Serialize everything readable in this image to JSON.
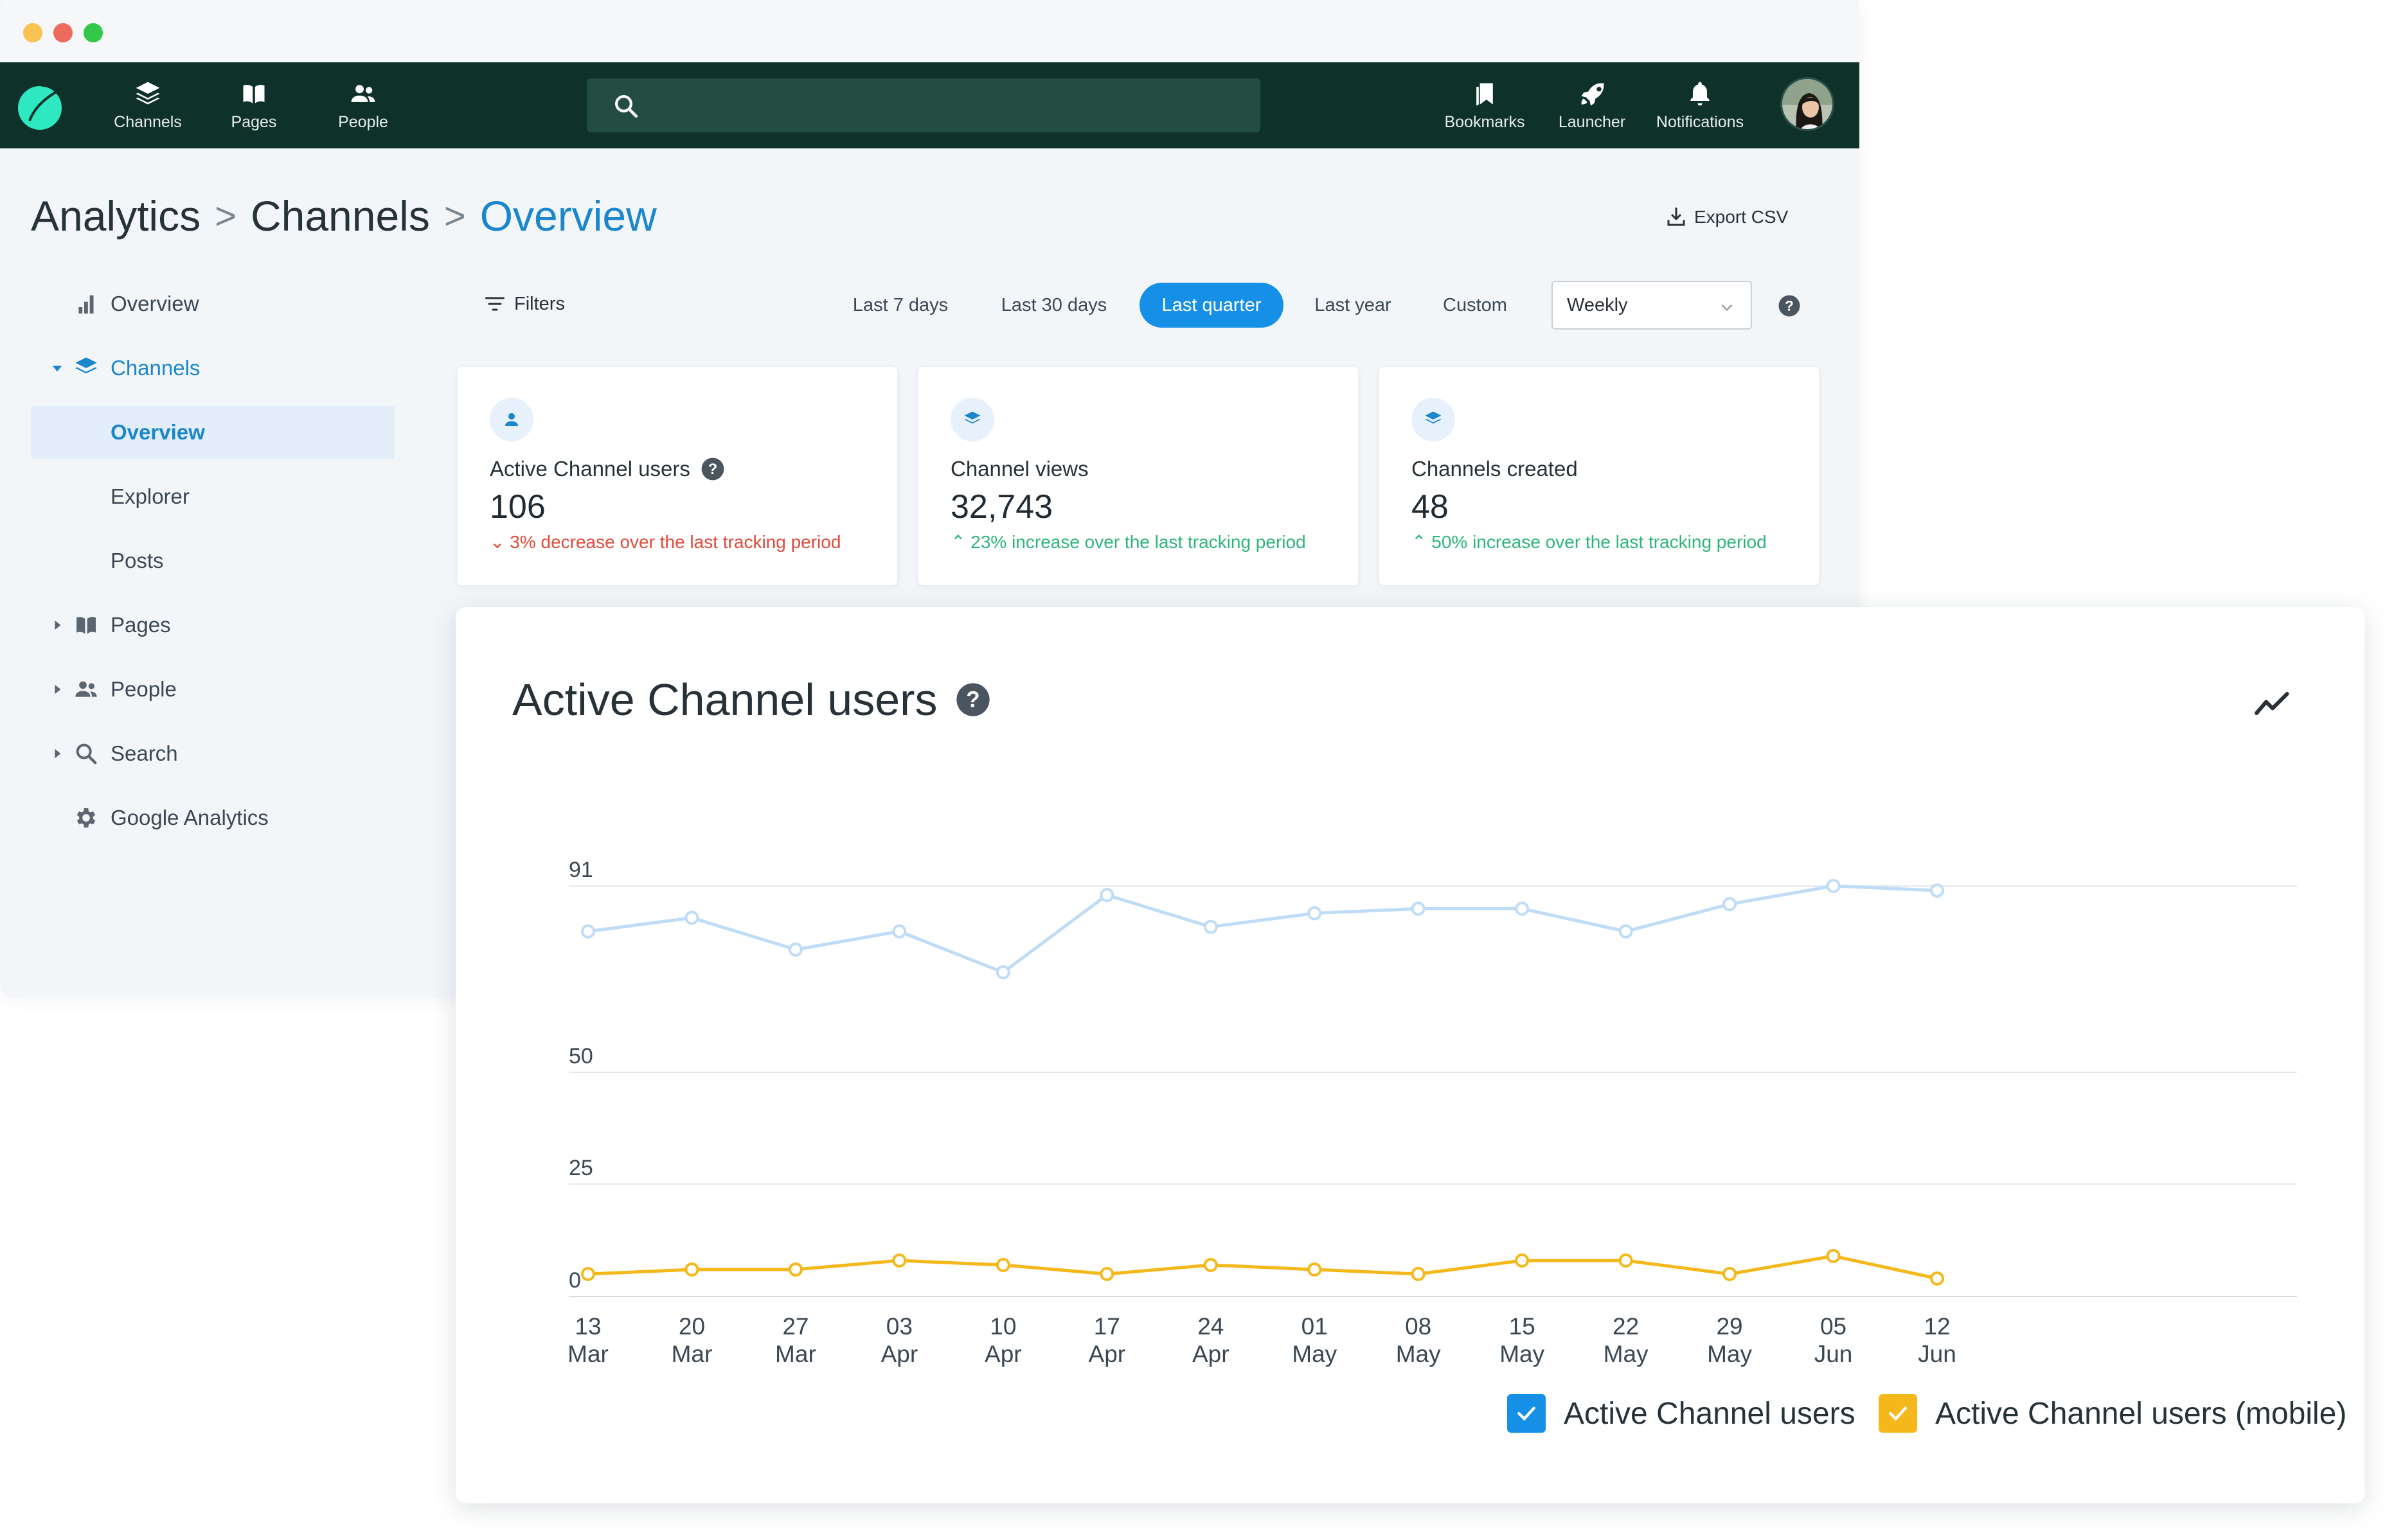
{
  "nav": {
    "items": [
      {
        "label": "Channels",
        "icon": "layers-icon"
      },
      {
        "label": "Pages",
        "icon": "book-icon"
      },
      {
        "label": "People",
        "icon": "people-icon"
      }
    ],
    "right_items": [
      {
        "label": "Bookmarks",
        "icon": "bookmark-icon"
      },
      {
        "label": "Launcher",
        "icon": "rocket-icon"
      },
      {
        "label": "Notifications",
        "icon": "bell-icon"
      }
    ]
  },
  "breadcrumb": {
    "root": "Analytics",
    "sep": ">",
    "middle": "Channels",
    "current": "Overview"
  },
  "export_label": "Export CSV",
  "sidebar": {
    "items": [
      {
        "label": "Overview"
      },
      {
        "label": "Channels"
      },
      {
        "label": "Overview"
      },
      {
        "label": "Explorer"
      },
      {
        "label": "Posts"
      },
      {
        "label": "Pages"
      },
      {
        "label": "People"
      },
      {
        "label": "Search"
      },
      {
        "label": "Google Analytics"
      }
    ]
  },
  "filters": {
    "label": "Filters",
    "ranges": [
      "Last 7 days",
      "Last 30 days",
      "Last quarter",
      "Last year",
      "Custom"
    ],
    "selected_range": "Last quarter",
    "granularity": "Weekly"
  },
  "cards": [
    {
      "label": "Active Channel users",
      "value": "106",
      "delta": "3% decrease over the last tracking period",
      "trend": "down"
    },
    {
      "label": "Channel views",
      "value": "32,743",
      "delta": "23% increase over the last tracking period",
      "trend": "up"
    },
    {
      "label": "Channels created",
      "value": "48",
      "delta": "50% increase over the last tracking period",
      "trend": "up"
    }
  ],
  "colors": {
    "nav_bg": "#0e3129",
    "accent": "#1690e6",
    "series_main": "#bfdcf7",
    "series_mobile": "#f5b81a",
    "decrease": "#e14a3a",
    "increase": "#2db47d"
  },
  "chart_data": {
    "type": "line",
    "title": "Active Channel users",
    "x_day": [
      "13",
      "20",
      "27",
      "03",
      "10",
      "17",
      "24",
      "01",
      "08",
      "15",
      "22",
      "29",
      "05",
      "12"
    ],
    "x_month": [
      "Mar",
      "Mar",
      "Mar",
      "Apr",
      "Apr",
      "Apr",
      "Apr",
      "May",
      "May",
      "May",
      "May",
      "May",
      "Jun",
      "Jun"
    ],
    "yticks": [
      0,
      25,
      50,
      91
    ],
    "grid": true,
    "legend_position": "bottom-right",
    "series": [
      {
        "name": "Active Channel users",
        "values": [
          81,
          84,
          77,
          81,
          72,
          89,
          82,
          85,
          86,
          86,
          81,
          87,
          91,
          90
        ],
        "color": "#bfdcf7"
      },
      {
        "name": "Active Channel users (mobile)",
        "values": [
          5,
          6,
          6,
          8,
          7,
          5,
          7,
          6,
          5,
          8,
          8,
          5,
          9,
          4
        ],
        "color": "#f5b81a"
      }
    ]
  }
}
